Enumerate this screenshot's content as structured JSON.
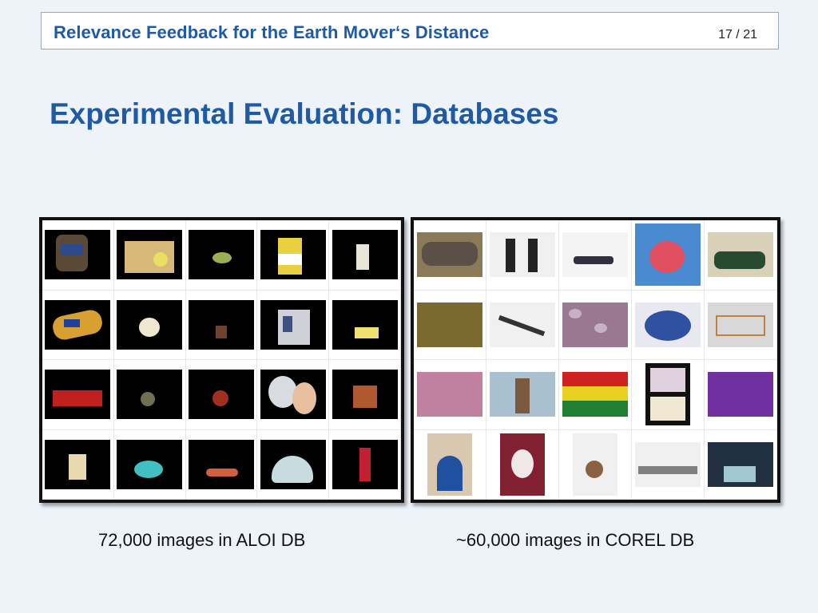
{
  "header": {
    "title": "Relevance Feedback for the Earth Mover‘s Distance",
    "page": "17 / 21"
  },
  "slide": {
    "title": "Experimental Evaluation: Databases"
  },
  "captions": {
    "aloi": "72,000 images in ALOI DB",
    "corel": "~60,000 images in COREL DB"
  }
}
